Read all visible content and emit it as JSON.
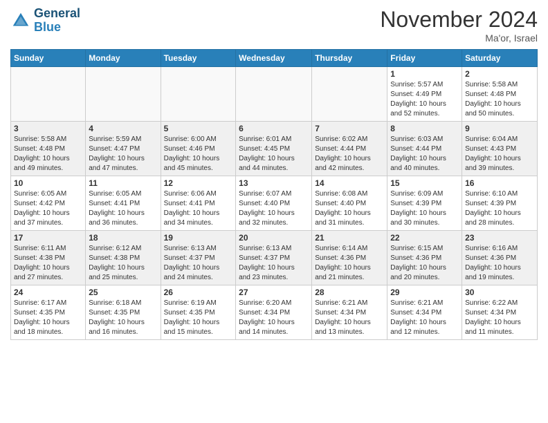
{
  "header": {
    "logo_line1": "General",
    "logo_line2": "Blue",
    "title": "November 2024",
    "location": "Ma'or, Israel"
  },
  "weekdays": [
    "Sunday",
    "Monday",
    "Tuesday",
    "Wednesday",
    "Thursday",
    "Friday",
    "Saturday"
  ],
  "weeks": [
    [
      {
        "day": "",
        "info": ""
      },
      {
        "day": "",
        "info": ""
      },
      {
        "day": "",
        "info": ""
      },
      {
        "day": "",
        "info": ""
      },
      {
        "day": "",
        "info": ""
      },
      {
        "day": "1",
        "info": "Sunrise: 5:57 AM\nSunset: 4:49 PM\nDaylight: 10 hours\nand 52 minutes."
      },
      {
        "day": "2",
        "info": "Sunrise: 5:58 AM\nSunset: 4:48 PM\nDaylight: 10 hours\nand 50 minutes."
      }
    ],
    [
      {
        "day": "3",
        "info": "Sunrise: 5:58 AM\nSunset: 4:48 PM\nDaylight: 10 hours\nand 49 minutes."
      },
      {
        "day": "4",
        "info": "Sunrise: 5:59 AM\nSunset: 4:47 PM\nDaylight: 10 hours\nand 47 minutes."
      },
      {
        "day": "5",
        "info": "Sunrise: 6:00 AM\nSunset: 4:46 PM\nDaylight: 10 hours\nand 45 minutes."
      },
      {
        "day": "6",
        "info": "Sunrise: 6:01 AM\nSunset: 4:45 PM\nDaylight: 10 hours\nand 44 minutes."
      },
      {
        "day": "7",
        "info": "Sunrise: 6:02 AM\nSunset: 4:44 PM\nDaylight: 10 hours\nand 42 minutes."
      },
      {
        "day": "8",
        "info": "Sunrise: 6:03 AM\nSunset: 4:44 PM\nDaylight: 10 hours\nand 40 minutes."
      },
      {
        "day": "9",
        "info": "Sunrise: 6:04 AM\nSunset: 4:43 PM\nDaylight: 10 hours\nand 39 minutes."
      }
    ],
    [
      {
        "day": "10",
        "info": "Sunrise: 6:05 AM\nSunset: 4:42 PM\nDaylight: 10 hours\nand 37 minutes."
      },
      {
        "day": "11",
        "info": "Sunrise: 6:05 AM\nSunset: 4:41 PM\nDaylight: 10 hours\nand 36 minutes."
      },
      {
        "day": "12",
        "info": "Sunrise: 6:06 AM\nSunset: 4:41 PM\nDaylight: 10 hours\nand 34 minutes."
      },
      {
        "day": "13",
        "info": "Sunrise: 6:07 AM\nSunset: 4:40 PM\nDaylight: 10 hours\nand 32 minutes."
      },
      {
        "day": "14",
        "info": "Sunrise: 6:08 AM\nSunset: 4:40 PM\nDaylight: 10 hours\nand 31 minutes."
      },
      {
        "day": "15",
        "info": "Sunrise: 6:09 AM\nSunset: 4:39 PM\nDaylight: 10 hours\nand 30 minutes."
      },
      {
        "day": "16",
        "info": "Sunrise: 6:10 AM\nSunset: 4:39 PM\nDaylight: 10 hours\nand 28 minutes."
      }
    ],
    [
      {
        "day": "17",
        "info": "Sunrise: 6:11 AM\nSunset: 4:38 PM\nDaylight: 10 hours\nand 27 minutes."
      },
      {
        "day": "18",
        "info": "Sunrise: 6:12 AM\nSunset: 4:38 PM\nDaylight: 10 hours\nand 25 minutes."
      },
      {
        "day": "19",
        "info": "Sunrise: 6:13 AM\nSunset: 4:37 PM\nDaylight: 10 hours\nand 24 minutes."
      },
      {
        "day": "20",
        "info": "Sunrise: 6:13 AM\nSunset: 4:37 PM\nDaylight: 10 hours\nand 23 minutes."
      },
      {
        "day": "21",
        "info": "Sunrise: 6:14 AM\nSunset: 4:36 PM\nDaylight: 10 hours\nand 21 minutes."
      },
      {
        "day": "22",
        "info": "Sunrise: 6:15 AM\nSunset: 4:36 PM\nDaylight: 10 hours\nand 20 minutes."
      },
      {
        "day": "23",
        "info": "Sunrise: 6:16 AM\nSunset: 4:36 PM\nDaylight: 10 hours\nand 19 minutes."
      }
    ],
    [
      {
        "day": "24",
        "info": "Sunrise: 6:17 AM\nSunset: 4:35 PM\nDaylight: 10 hours\nand 18 minutes."
      },
      {
        "day": "25",
        "info": "Sunrise: 6:18 AM\nSunset: 4:35 PM\nDaylight: 10 hours\nand 16 minutes."
      },
      {
        "day": "26",
        "info": "Sunrise: 6:19 AM\nSunset: 4:35 PM\nDaylight: 10 hours\nand 15 minutes."
      },
      {
        "day": "27",
        "info": "Sunrise: 6:20 AM\nSunset: 4:34 PM\nDaylight: 10 hours\nand 14 minutes."
      },
      {
        "day": "28",
        "info": "Sunrise: 6:21 AM\nSunset: 4:34 PM\nDaylight: 10 hours\nand 13 minutes."
      },
      {
        "day": "29",
        "info": "Sunrise: 6:21 AM\nSunset: 4:34 PM\nDaylight: 10 hours\nand 12 minutes."
      },
      {
        "day": "30",
        "info": "Sunrise: 6:22 AM\nSunset: 4:34 PM\nDaylight: 10 hours\nand 11 minutes."
      }
    ]
  ]
}
